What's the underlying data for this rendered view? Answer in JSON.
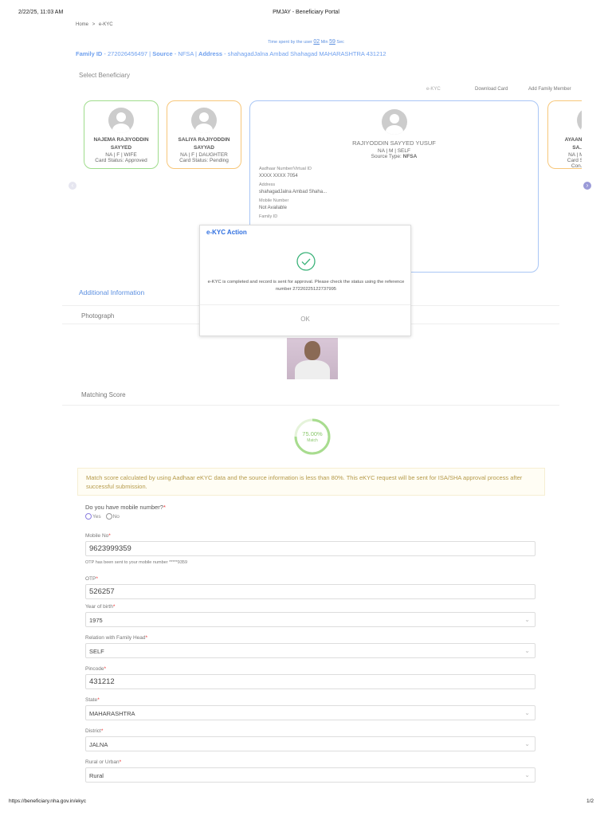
{
  "print_header": {
    "datetime": "2/22/25, 11:03 AM",
    "title": "PMJAY - Beneficiary Portal"
  },
  "breadcrumb": {
    "home": "Home",
    "separator": ">",
    "current": "e-KYC"
  },
  "timer": {
    "prefix": "Time spent by the user",
    "minutes": "02",
    "min_label": "Min",
    "seconds": "59",
    "sec_label": "Sec"
  },
  "family_info": {
    "family_id_label": "Family ID",
    "family_id": "272026456497",
    "source_label": "Source",
    "source": "NFSA",
    "address_label": "Address",
    "address": "shahagadJalna Ambad Shahagad MAHARASHTRA 431212"
  },
  "select_beneficiary": "Select Beneficiary",
  "tabs": [
    "e-KYC",
    "Download Card",
    "Add Family Member"
  ],
  "cards": [
    {
      "name": "NAJEMA RAJIYODDIN SAYYED",
      "details": "NA | F | WIFE",
      "status": "Card Status: Approved"
    },
    {
      "name": "SALIYA RAJIYODDIN SAYYAD",
      "details": "NA | F | DAUGHTER",
      "status": "Card Status: Pending"
    },
    {
      "name": "AYAAN R... SA...",
      "details": "NA | M...",
      "status": "Card St...",
      "extra": "Con..."
    }
  ],
  "selected": {
    "name": "RAJIYODDIN SAYYED YUSUF",
    "details": "NA | M | SELF",
    "source_type_label": "Source Type:",
    "source_type": "NFSA",
    "fields": [
      {
        "label": "Aadhaar Number/Virtual ID",
        "value": "XXXX XXXX 7054"
      },
      {
        "label": "Address",
        "value": "shahagadJalna Ambad Shaha..."
      },
      {
        "label": "Mobile Number",
        "value": "Not Available"
      },
      {
        "label": "Family ID",
        "value": ""
      }
    ]
  },
  "modal": {
    "title": "e-KYC Action",
    "message": "e-KYC is completed and record is sent for approval. Please check the status using the reference number 27220225122737995",
    "ok": "OK"
  },
  "additional_info": "Additional Information",
  "photograph": "Photograph",
  "matching_score": {
    "title": "Matching Score",
    "value": "75.00%",
    "label": "Match",
    "percent": 75
  },
  "alert": "Match score calculated by using Aadhaar eKYC data and the source information is less than 80%. This eKYC request will be sent for ISA/SHA approval process after successful submission.",
  "mobile_question": {
    "label": "Do you have mobile number?",
    "options": [
      "Yes",
      "No"
    ]
  },
  "form": {
    "mobile": {
      "label": "Mobile No",
      "value": "9623999359",
      "note": "OTP has been sent to your mobile number *****9359"
    },
    "otp": {
      "label": "OTP",
      "value": "526257"
    },
    "yob": {
      "label": "Year of birth",
      "value": "1975"
    },
    "relation": {
      "label": "Relation with Family Head",
      "value": "SELF"
    },
    "pincode": {
      "label": "Pincode",
      "value": "431212"
    },
    "state": {
      "label": "State",
      "value": "MAHARASHTRA"
    },
    "district": {
      "label": "District",
      "value": "JALNA"
    },
    "rural": {
      "label": "Rural or Urban",
      "value": "Rural"
    }
  },
  "footer": {
    "url": "https://beneficiary.nha.gov.in/ekyc",
    "page": "1/2"
  },
  "colors": {
    "accent": "#3b82f6",
    "green": "#8fd17a",
    "orange": "#f7c77a",
    "alert_text": "#b59a4a"
  }
}
